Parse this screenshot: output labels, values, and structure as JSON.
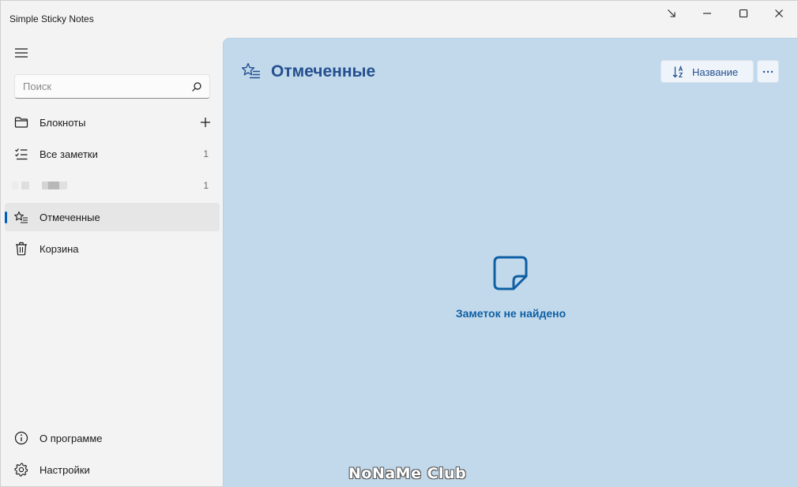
{
  "window": {
    "title": "Simple Sticky Notes",
    "controls": {
      "pin_icon": "arrow-down-right-icon",
      "minimize_icon": "minimize-icon",
      "maximize_icon": "maximize-icon",
      "close_icon": "close-icon"
    }
  },
  "sidebar": {
    "search": {
      "placeholder": "Поиск",
      "value": ""
    },
    "items": [
      {
        "label": "Блокноты",
        "icon": "folder-icon",
        "action_icon": "plus-icon"
      },
      {
        "label": "Все заметки",
        "icon": "checklist-icon",
        "count": "1"
      },
      {
        "label": "",
        "icon": "notebook-color-icon",
        "count": "1"
      },
      {
        "label": "Отмеченные",
        "icon": "star-list-icon",
        "selected": true
      },
      {
        "label": "Корзина",
        "icon": "trash-icon"
      }
    ],
    "footer": [
      {
        "label": "О программе",
        "icon": "info-icon"
      },
      {
        "label": "Настройки",
        "icon": "gear-icon"
      }
    ]
  },
  "main": {
    "title": "Отмеченные",
    "title_icon": "star-list-icon",
    "sort_button": {
      "label": "Название",
      "icon": "sort-az-icon"
    },
    "more_button": {
      "label": "···"
    },
    "empty_state": {
      "icon": "sticky-note-icon",
      "message": "Заметок не найдено"
    }
  },
  "watermark": "NoNaMe Club",
  "colors": {
    "accent": "#005fb8",
    "main_background": "#c2d9ec",
    "title_color": "#24508f",
    "empty_text_color": "#0f5fa3",
    "sidebar_background": "#f3f3f3"
  }
}
